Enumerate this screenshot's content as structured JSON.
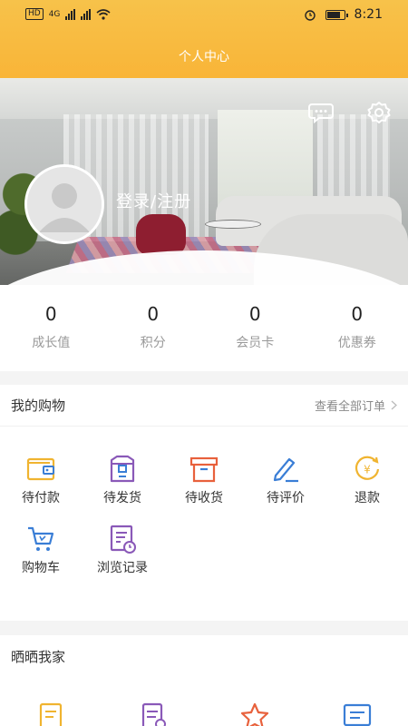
{
  "status": {
    "network": "4G",
    "time": "8:21"
  },
  "header": {
    "title": "个人中心"
  },
  "profile": {
    "login_label": "登录/注册"
  },
  "stats": [
    {
      "value": "0",
      "label": "成长值"
    },
    {
      "value": "0",
      "label": "积分"
    },
    {
      "value": "0",
      "label": "会员卡"
    },
    {
      "value": "0",
      "label": "优惠券"
    }
  ],
  "shopping": {
    "title": "我的购物",
    "more_label": "查看全部订单",
    "items": [
      {
        "label": "待付款",
        "icon": "wallet-icon"
      },
      {
        "label": "待发货",
        "icon": "package-icon"
      },
      {
        "label": "待收货",
        "icon": "box-icon"
      },
      {
        "label": "待评价",
        "icon": "pen-icon"
      },
      {
        "label": "退款",
        "icon": "refund-icon"
      },
      {
        "label": "购物车",
        "icon": "cart-icon"
      },
      {
        "label": "浏览记录",
        "icon": "history-icon"
      }
    ]
  },
  "home": {
    "title": "晒晒我家",
    "icons": [
      "note-icon",
      "list-icon",
      "star-icon",
      "comment-icon"
    ]
  },
  "colors": {
    "accent": "#f9b437",
    "orange": "#e8613c",
    "blue": "#3a7ed6",
    "purple": "#8a59b8"
  }
}
